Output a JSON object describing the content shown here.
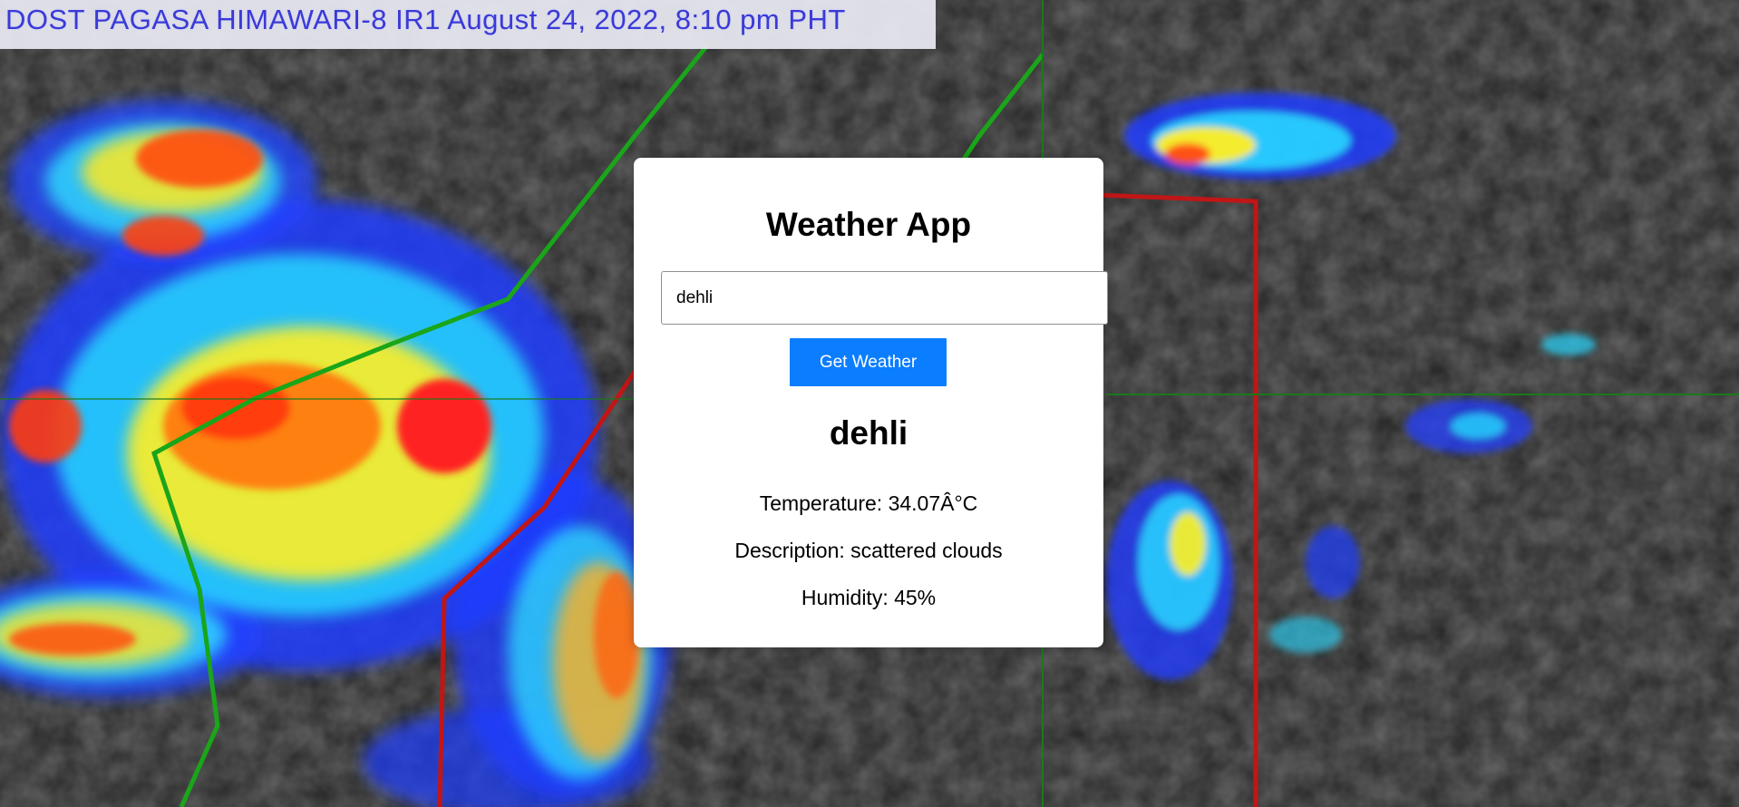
{
  "background": {
    "caption": "DOST PAGASA HIMAWARI-8 IR1 August 24, 2022, 8:10 pm PHT"
  },
  "app": {
    "title": "Weather App",
    "search": {
      "value": "dehli"
    },
    "button_label": "Get Weather",
    "result": {
      "city": "dehli",
      "temperature_line": "Temperature: 34.07Â°C",
      "description_line": "Description: scattered clouds",
      "humidity_line": "Humidity: 45%"
    }
  },
  "colors": {
    "accent": "#0b7dff",
    "card_background": "#ffffff"
  }
}
